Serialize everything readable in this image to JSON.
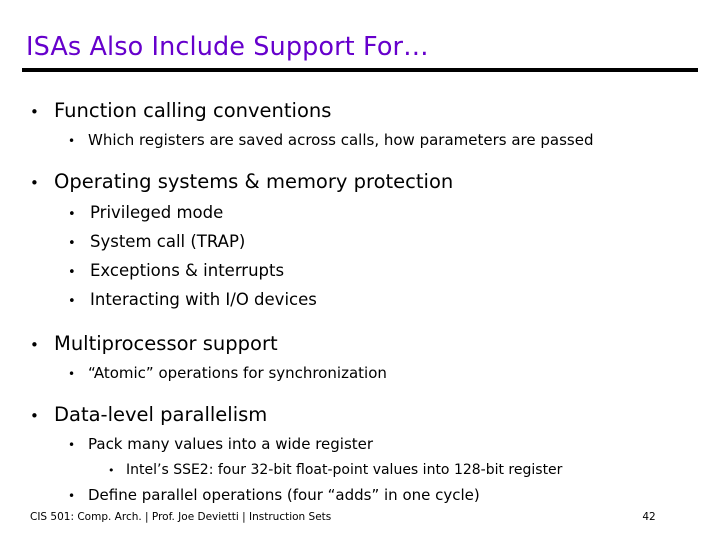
{
  "slide": {
    "title": "ISAs Also Include Support For…",
    "title_color": "#6600cc",
    "rule_color": "#000000",
    "background": "#ffffff",
    "text_color": "#000000",
    "bullet_glyph": "•",
    "content": [
      {
        "level": 1,
        "text": "Function calling conventions"
      },
      {
        "level": 2,
        "text": "Which registers are saved across calls, how parameters are passed"
      },
      {
        "level": 1,
        "text": "Operating systems & memory protection"
      },
      {
        "level": 2,
        "text": "Privileged mode"
      },
      {
        "level": 2,
        "text": "System call (TRAP)"
      },
      {
        "level": 2,
        "text": "Exceptions & interrupts"
      },
      {
        "level": 2,
        "text": "Interacting with I/O devices"
      },
      {
        "level": 1,
        "text": "Multiprocessor support"
      },
      {
        "level": 2,
        "text": "“Atomic” operations for synchronization"
      },
      {
        "level": 1,
        "text": "Data-level parallelism"
      },
      {
        "level": 2,
        "text": "Pack many values into a wide register"
      },
      {
        "level": 3,
        "text": "Intel’s SSE2: four 32-bit float-point values into 128-bit register"
      },
      {
        "level": 2,
        "text": "Define parallel operations (four “adds” in one cycle)"
      }
    ]
  },
  "footer": {
    "text": "CIS 501: Comp. Arch.  |  Prof. Joe Devietti  |  Instruction Sets",
    "page_number": "42"
  }
}
